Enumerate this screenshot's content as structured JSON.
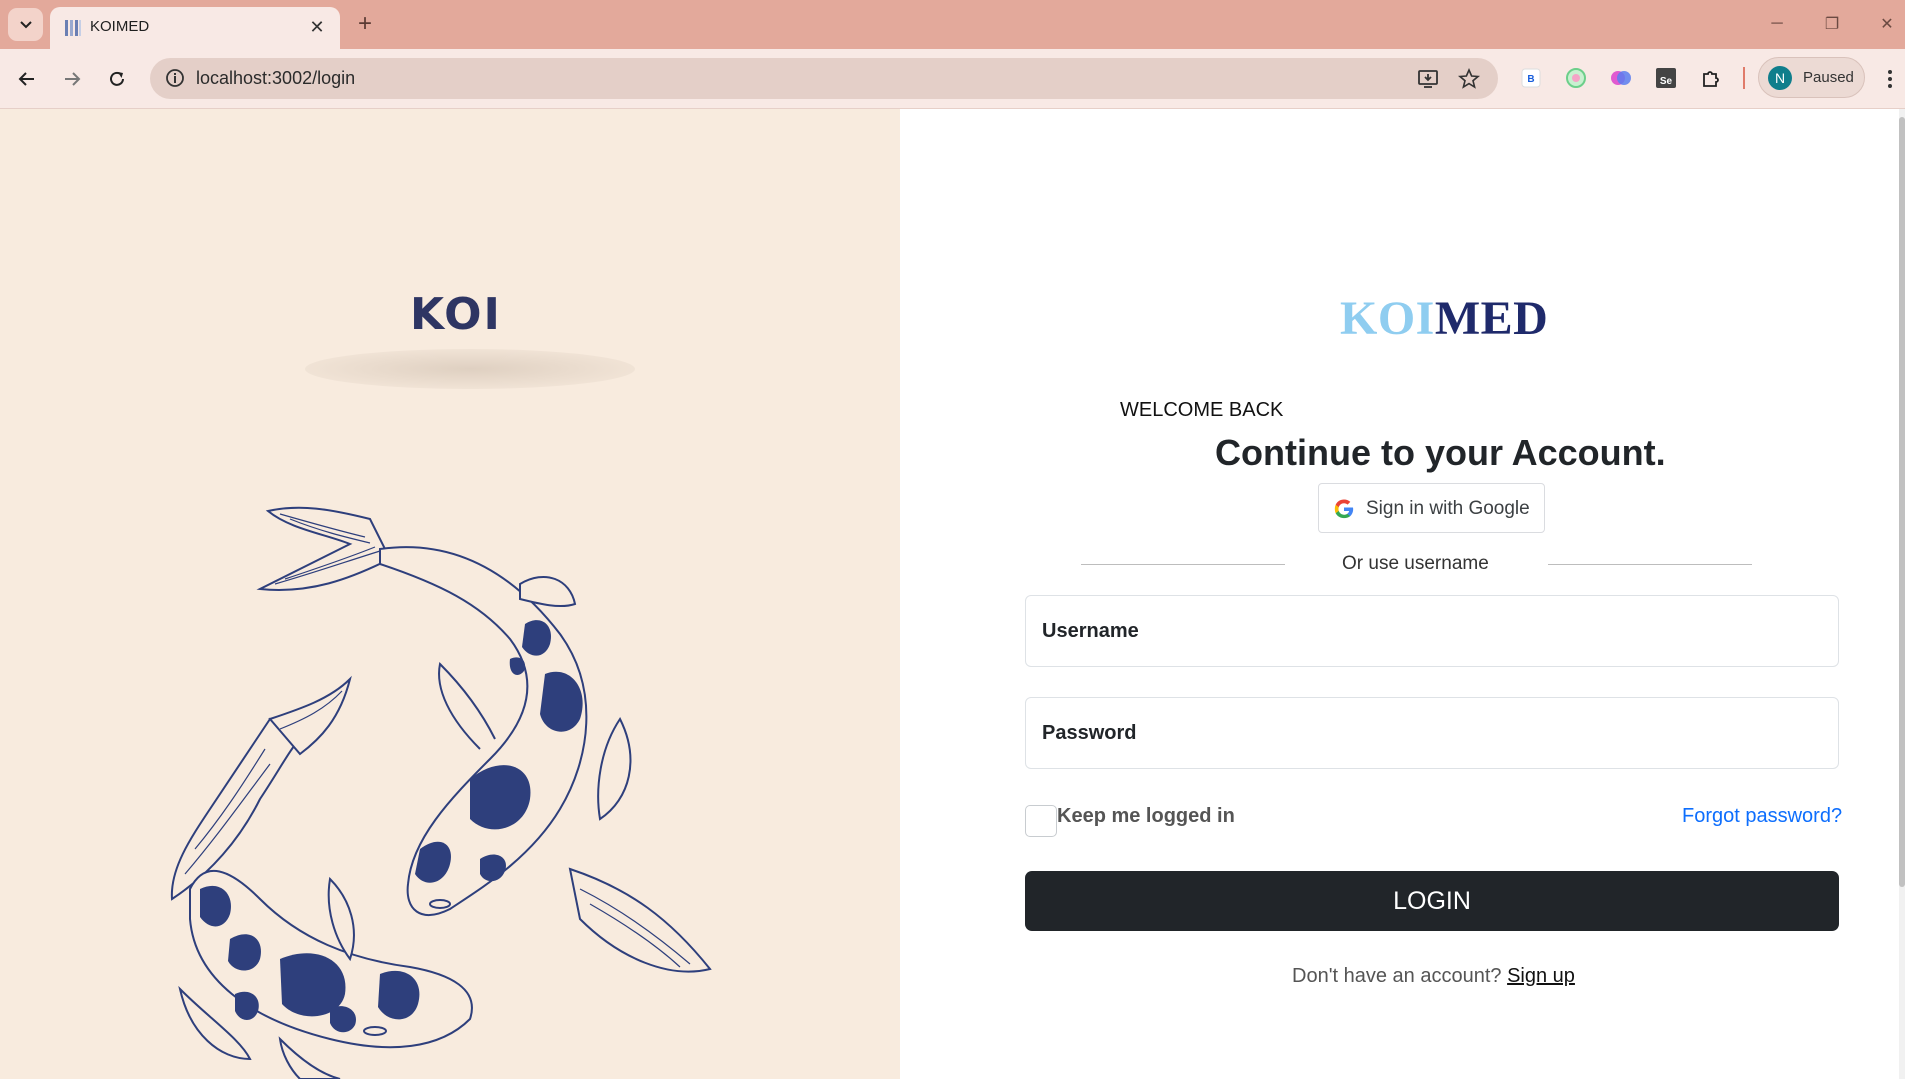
{
  "browser": {
    "tab_title": "KOIMED",
    "url": "localhost:3002/login",
    "profile_initial": "N",
    "profile_status": "Paused",
    "extensions": [
      "bitwarden-icon",
      "circle-extension-icon",
      "brain-extension-icon",
      "selenium-icon",
      "puzzle-icon"
    ]
  },
  "left_panel": {
    "logo_text": "KOI"
  },
  "login": {
    "brand_part1": "KOI",
    "brand_part2": "MED",
    "welcome": "WELCOME BACK",
    "headline": "Continue to your Account.",
    "google_label": "Sign in with Google",
    "divider_text": "Or use username",
    "username_label": "Username",
    "password_label": "Password",
    "remember_label": "Keep me logged in",
    "forgot_label": "Forgot password?",
    "login_label": "LOGIN",
    "signup_prompt": "Don't have an account?",
    "signup_link": "Sign up"
  },
  "colors": {
    "tabbar": "#e3a99b",
    "left_bg": "#f8ebde",
    "fish_blue": "#2e3f7c",
    "brand_light": "#8fcdf0",
    "brand_dark": "#1f2a6b",
    "button_dark": "#212529",
    "link_blue": "#0d6efd"
  }
}
